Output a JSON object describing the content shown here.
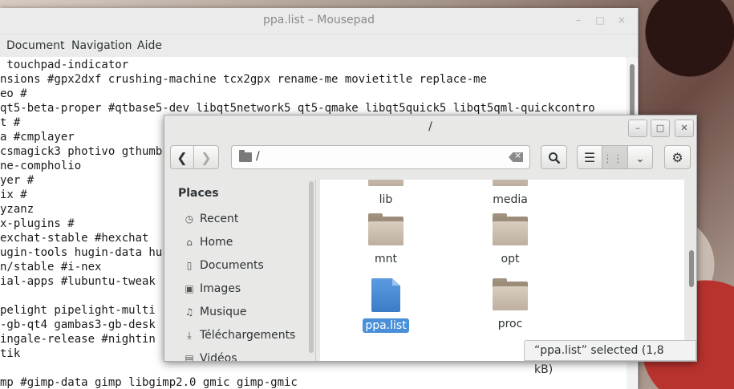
{
  "mousepad": {
    "title": "ppa.list – Mousepad",
    "menu": [
      "Document",
      "Navigation",
      "Aide"
    ],
    "lines": [
      " touchpad-indicator",
      "nsions #gpx2dxf crushing-machine tcx2gpx rename-me movietitle replace-me",
      "eo #",
      "qt5-beta-proper #qtbase5-dev libqt5network5 qt5-qmake libqt5quick5 libqt5qml-quickcontro",
      "t #",
      "a #cmplayer",
      "csmagick3 photivo gthumb",
      "ne-compholio",
      "yer #",
      "ix #",
      "yzanz",
      "x-plugins #",
      "exchat-stable #hexchat",
      "ugin-tools hugin-data hu",
      "n/stable #i-nex",
      "ial-apps #lubuntu-tweak",
      "",
      "pelight pipelight-multi",
      "-gb-qt4 gambas3-gb-desk",
      "ingale-release #nightin",
      "tik",
      "",
      "mp #gimp-data gimp libgimp2.0 gmic gimp-gmic"
    ]
  },
  "chooser": {
    "title": "/",
    "location_path": "/",
    "icons": {
      "back": "chevron-left-icon",
      "forward": "chevron-right-icon",
      "search": "search-icon",
      "list_view": "list-view-icon",
      "grid_view": "grid-view-icon",
      "dropdown": "chevron-down-icon",
      "settings": "gear-icon"
    },
    "places_heading": "Places",
    "places": [
      {
        "label": "Recent",
        "icon": "clock-icon",
        "glyph": "◷"
      },
      {
        "label": "Home",
        "icon": "home-icon",
        "glyph": "⌂"
      },
      {
        "label": "Documents",
        "icon": "document-icon",
        "glyph": "▯"
      },
      {
        "label": "Images",
        "icon": "camera-icon",
        "glyph": "▣"
      },
      {
        "label": "Musique",
        "icon": "music-icon",
        "glyph": "♫"
      },
      {
        "label": "Téléchargements",
        "icon": "download-icon",
        "glyph": "⤓"
      },
      {
        "label": "Vidéos",
        "icon": "video-icon",
        "glyph": "▤"
      }
    ],
    "files": [
      {
        "name": "lib",
        "type": "folder"
      },
      {
        "name": "media",
        "type": "folder"
      },
      {
        "name": "mnt",
        "type": "folder"
      },
      {
        "name": "opt",
        "type": "folder"
      },
      {
        "name": "ppa.list",
        "type": "file",
        "selected": true
      },
      {
        "name": "proc",
        "type": "folder"
      }
    ],
    "status": "“ppa.list” selected  (1,8 kB)",
    "colors": {
      "selection": "#4a90d9",
      "file_icon": "#3a7cc7"
    }
  }
}
